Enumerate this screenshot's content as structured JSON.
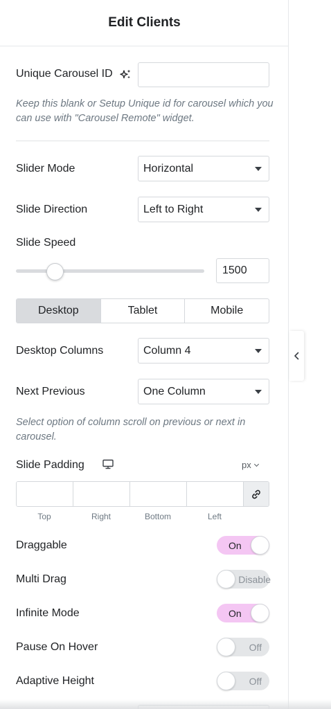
{
  "header": {
    "title": "Edit Clients"
  },
  "carousel_id": {
    "label": "Unique Carousel ID",
    "value": "",
    "hint": "Keep this blank or Setup Unique id for carousel which you can use with \"Carousel Remote\" widget."
  },
  "slider_mode": {
    "label": "Slider Mode",
    "value": "Horizontal"
  },
  "slide_direction": {
    "label": "Slide Direction",
    "value": "Left to Right"
  },
  "slide_speed": {
    "label": "Slide Speed",
    "value": "1500",
    "fraction": 0.15
  },
  "device_tabs": {
    "items": [
      "Desktop",
      "Tablet",
      "Mobile"
    ],
    "active": "Desktop"
  },
  "desktop_columns": {
    "label": "Desktop Columns",
    "value": "Column 4"
  },
  "next_previous": {
    "label": "Next Previous",
    "value": "One Column",
    "hint": "Select option of column scroll on previous or next in carousel."
  },
  "slide_padding": {
    "label": "Slide Padding",
    "unit": "px",
    "fields": [
      "Top",
      "Right",
      "Bottom",
      "Left"
    ]
  },
  "toggles": {
    "draggable": {
      "label": "Draggable",
      "state": "On"
    },
    "multi_drag": {
      "label": "Multi Drag",
      "state": "Disable"
    },
    "infinite_mode": {
      "label": "Infinite Mode",
      "state": "On"
    },
    "pause_on_hover": {
      "label": "Pause On Hover",
      "state": "Off"
    },
    "adaptive_height": {
      "label": "Adaptive Height",
      "state": "Off"
    }
  },
  "colors": {
    "toggle_on": "#f4c6f3",
    "toggle_off": "#e4e6e8",
    "active_tab": "#d9dbde"
  },
  "icons": [
    "ai-sparkle-icon",
    "monitor-icon",
    "link-icon",
    "chevron-left-icon",
    "chevron-down-icon"
  ]
}
